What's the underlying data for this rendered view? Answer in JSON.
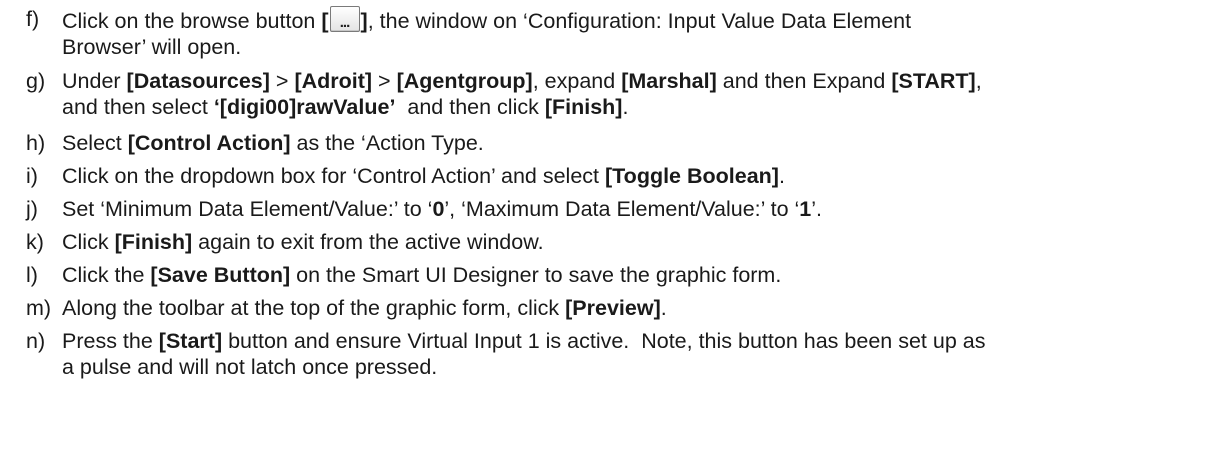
{
  "steps": [
    {
      "marker": "f)",
      "pre": "Click on the browse button ",
      "bracket_open": "[",
      "icon": "browse-ellipsis-icon",
      "icon_glyph": "...",
      "bracket_close": "]",
      "post": ", the window on ‘Configuration: Input Value Data Element",
      "line2": "Browser’ will open."
    },
    {
      "marker": "g)",
      "t1": "Under ",
      "b1": "[Datasources]",
      "t2": " > ",
      "b2": "[Adroit]",
      "t3": " > ",
      "b3": "[Agentgroup]",
      "t4": ", expand ",
      "b4": "[Marshal]",
      "t5": " and then Expand ",
      "b5": "[START]",
      "t6": ",",
      "l2t1": "and then select ",
      "l2b1": "‘[digi00]rawValue’",
      "l2t2": "  and then click ",
      "l2b2": "[Finish]",
      "l2t3": "."
    },
    {
      "marker": "h)",
      "t1": "Select ",
      "b1": "[Control Action]",
      "t2": " as the ‘Action Type."
    },
    {
      "marker": "i)",
      "t1": "Click on the dropdown box for ‘Control Action’ and select ",
      "b1": "[Toggle Boolean]",
      "t2": "."
    },
    {
      "marker": "j)",
      "t1": "Set ‘Minimum Data Element/Value:’ to ‘",
      "b1": "0",
      "t2": "’, ‘Maximum Data Element/Value:’ to ‘",
      "b2": "1",
      "t3": "’."
    },
    {
      "marker": "k)",
      "t1": "Click ",
      "b1": "[Finish]",
      "t2": " again to exit from the active window."
    },
    {
      "marker": "l)",
      "t1": "Click the ",
      "b1": "[Save Button]",
      "t2": " on the Smart UI Designer to save the graphic form."
    },
    {
      "marker": "m)",
      "t1": "Along the toolbar at the top of the graphic form, click ",
      "b1": "[Preview]",
      "t2": "."
    },
    {
      "marker": "n)",
      "t1": "Press the ",
      "b1": "[Start]",
      "t2": " button and ensure Virtual Input 1 is active.  Note, this button has been set up as",
      "line2": "a pulse and will not latch once pressed."
    }
  ]
}
